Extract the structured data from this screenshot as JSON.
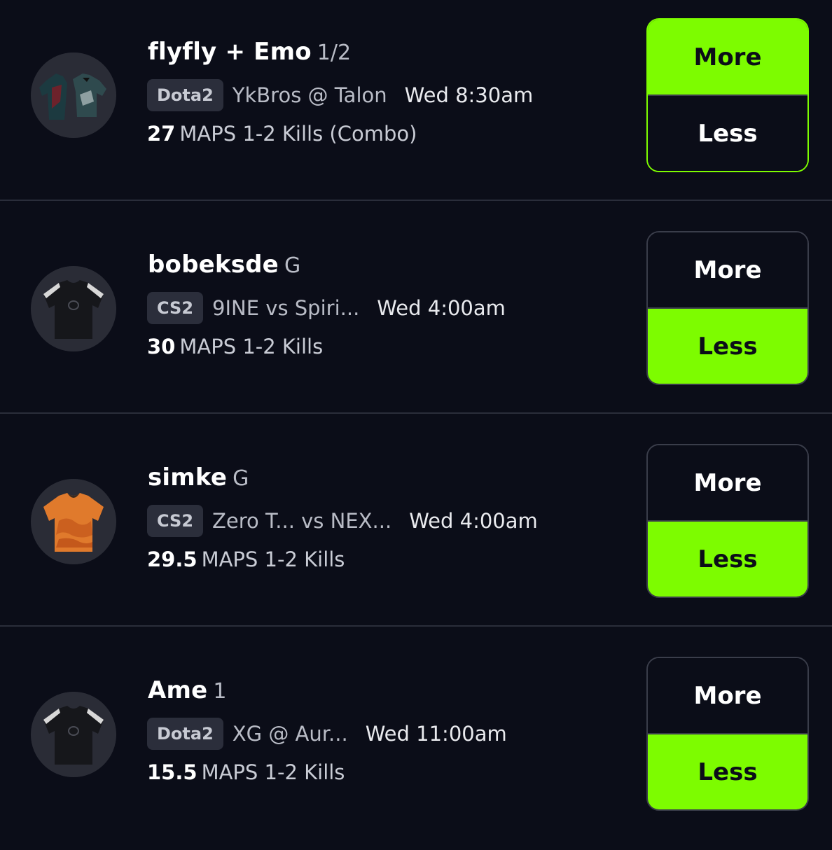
{
  "colors": {
    "background": "#0b0d18",
    "accent": "#7dfc00",
    "badge_bg": "#2b2e3b",
    "divider": "#2a2d3a"
  },
  "picks": [
    {
      "name": "flyfly + Emo",
      "suffix": "1/2",
      "game": "Dota2",
      "matchup": "YkBros @ Talon",
      "time": "Wed 8:30am",
      "line_value": "27",
      "stat": "MAPS 1-2 Kills (Combo)",
      "more_label": "More",
      "less_label": "Less",
      "selected": "More",
      "avatar_icon": "dual-jersey-icon"
    },
    {
      "name": "bobeksde",
      "suffix": "G",
      "game": "CS2",
      "matchup": "9INE vs Spiri...",
      "time": "Wed 4:00am",
      "line_value": "30",
      "stat": "MAPS 1-2 Kills",
      "more_label": "More",
      "less_label": "Less",
      "selected": "Less",
      "avatar_icon": "black-jersey-icon"
    },
    {
      "name": "simke",
      "suffix": "G",
      "game": "CS2",
      "matchup": "Zero T... vs NEX...",
      "time": "Wed 4:00am",
      "line_value": "29.5",
      "stat": "MAPS 1-2 Kills",
      "more_label": "More",
      "less_label": "Less",
      "selected": "Less",
      "avatar_icon": "orange-jersey-icon"
    },
    {
      "name": "Ame",
      "suffix": "1",
      "game": "Dota2",
      "matchup": "XG @ Aur...",
      "time": "Wed 11:00am",
      "line_value": "15.5",
      "stat": "MAPS 1-2 Kills",
      "more_label": "More",
      "less_label": "Less",
      "selected": "Less",
      "avatar_icon": "black-jersey-icon"
    }
  ]
}
